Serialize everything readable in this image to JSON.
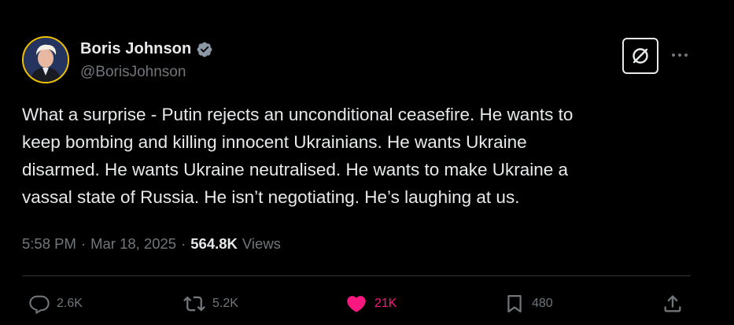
{
  "author": {
    "display_name": "Boris Johnson",
    "handle": "@BorisJohnson",
    "verified_icon": "verified-badge-icon"
  },
  "tweet": {
    "text": "What a surprise - Putin rejects an unconditional ceasefire. He wants to\nkeep bombing and killing innocent Ukrainians. He wants Ukraine\ndisarmed. He wants Ukraine neutralised. He wants to make Ukraine a\nvassal state of Russia. He isn’t negotiating. He’s laughing at us."
  },
  "meta": {
    "time": "5:58 PM",
    "separator": "·",
    "date": "Mar 18, 2025",
    "views_count": "564.8K",
    "views_label": "Views"
  },
  "actions": {
    "replies": "2.6K",
    "reposts": "5.2K",
    "likes": "21K",
    "bookmarks": "480"
  },
  "colors": {
    "background": "#000000",
    "text": "#e7e9ea",
    "muted": "#71767b",
    "like": "#f91880",
    "verified": "#1d9bf0"
  }
}
